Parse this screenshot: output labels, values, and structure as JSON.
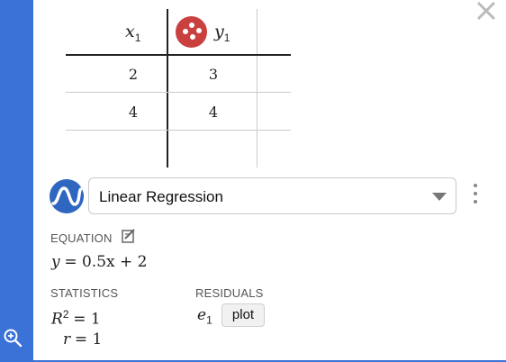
{
  "table": {
    "headers": {
      "x": {
        "base": "x",
        "sub": "1"
      },
      "y": {
        "base": "y",
        "sub": "1"
      }
    },
    "rows": [
      {
        "x": "2",
        "y": "3"
      },
      {
        "x": "4",
        "y": "4"
      }
    ]
  },
  "regression": {
    "model_label": "Linear Regression"
  },
  "equation": {
    "label": "EQUATION",
    "lhs": "y",
    "rhs": "= 0.5x + 2"
  },
  "statistics": {
    "label": "STATISTICS",
    "r2_base": "R",
    "r2_sup": "2",
    "r2_value": "= 1",
    "r_base": "r",
    "r_value": "= 1"
  },
  "residuals": {
    "label": "RESIDUALS",
    "var_base": "e",
    "var_sub": "1",
    "plot_label": "plot"
  },
  "colors": {
    "accent": "#3a72d8",
    "point_badge": "#c9403f",
    "regression_icon": "#2f67c0"
  },
  "icons": [
    "zoom-in-icon",
    "close-icon",
    "point-style-badge-icon",
    "regression-model-icon",
    "chevron-down-icon",
    "kebab-menu-icon",
    "edit-icon"
  ]
}
